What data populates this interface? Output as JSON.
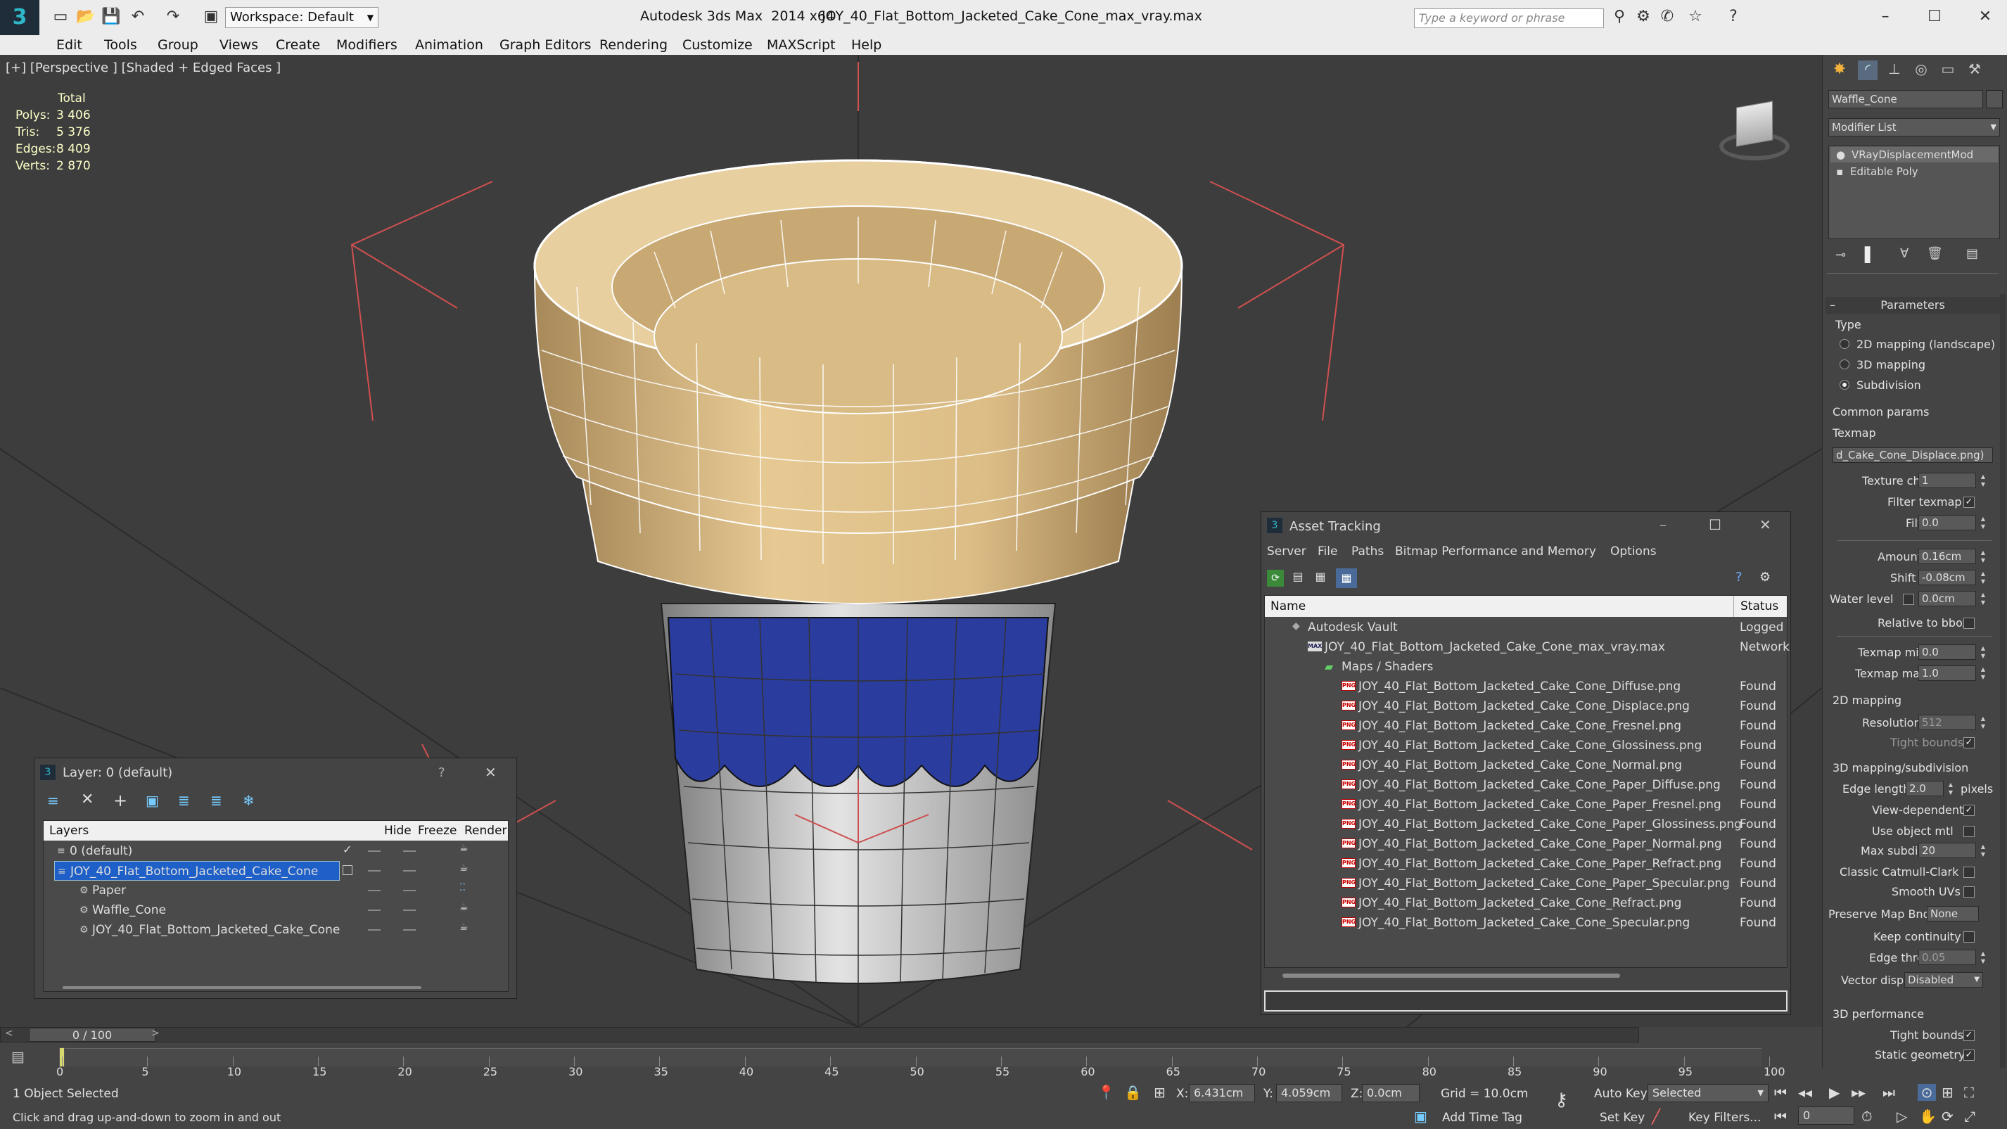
{
  "titlebar": {
    "app_title": "Autodesk 3ds Max  2014 x64",
    "file_title": "JOY_40_Flat_Bottom_Jacketed_Cake_Cone_max_vray.max",
    "workspace": "Workspace: Default",
    "search_placeholder": "Type a keyword or phrase"
  },
  "menu": [
    "Edit",
    "Tools",
    "Group",
    "Views",
    "Create",
    "Modifiers",
    "Animation",
    "Graph Editors",
    "Rendering",
    "Customize",
    "MAXScript",
    "Help"
  ],
  "viewport": {
    "label": "[+] [Perspective ] [Shaded + Edged Faces ]",
    "stats": {
      "header": "Total",
      "rows": [
        {
          "label": "Polys:",
          "value": "3 406"
        },
        {
          "label": "Tris:",
          "value": "5 376"
        },
        {
          "label": "Edges:",
          "value": "8 409"
        },
        {
          "label": "Verts:",
          "value": "2 870"
        }
      ]
    }
  },
  "command_panel": {
    "object_name": "Waffle_Cone",
    "modifier_list": "Modifier List",
    "stack": [
      "VRayDisplacementMod",
      "Editable Poly"
    ],
    "rollout_title": "Parameters",
    "type_label": "Type",
    "types": [
      {
        "label": "2D mapping (landscape)",
        "selected": false
      },
      {
        "label": "3D mapping",
        "selected": false
      },
      {
        "label": "Subdivision",
        "selected": true
      }
    ],
    "common_params": "Common params",
    "texmap_label": "Texmap",
    "texmap_value": "d_Cake_Cone_Displace.png)",
    "texture_chan_label": "Texture chan",
    "texture_chan_value": "1",
    "filter_texmap_label": "Filter texmap",
    "filter_blur_label": "Filter blur",
    "filter_blur_value": "0.0",
    "amount_label": "Amount",
    "amount_value": "0.16cm",
    "shift_label": "Shift",
    "shift_value": "-0.08cm",
    "water_level_label": "Water level",
    "water_level_value": "0.0cm",
    "relative_bbox_label": "Relative to bbox",
    "texmap_min_label": "Texmap min",
    "texmap_min_value": "0.0",
    "texmap_max_label": "Texmap max",
    "texmap_max_value": "1.0",
    "mapping_2d": "2D mapping",
    "resolution_label": "Resolution",
    "resolution_value": "512",
    "tight_bounds_label": "Tight bounds",
    "subdiv_3d": "3D mapping/subdivision",
    "edge_length_label": "Edge length",
    "edge_length_value": "2.0",
    "pixels_label": "pixels",
    "view_dependent_label": "View-dependent",
    "use_object_mtl_label": "Use object mtl",
    "max_subdivs_label": "Max subdivs",
    "max_subdivs_value": "20",
    "classic_catmull_label": "Classic Catmull-Clark",
    "smooth_uvs_label": "Smooth UVs",
    "preserve_map_label": "Preserve Map Bnd",
    "preserve_map_value": "None",
    "keep_continuity_label": "Keep continuity",
    "edge_thresh_label": "Edge thresh",
    "edge_thresh_value": "0.05",
    "vector_displ_label": "Vector displ",
    "vector_displ_value": "Disabled",
    "perf_3d": "3D performance",
    "tight_bounds2_label": "Tight bounds",
    "static_geometry_label": "Static geometry"
  },
  "asset_tracking": {
    "title": "Asset Tracking",
    "menu": [
      "Server",
      "File",
      "Paths",
      "Bitmap Performance and Memory",
      "Options"
    ],
    "col_name": "Name",
    "col_status": "Status",
    "vault": {
      "name": "Autodesk Vault",
      "status": "Logged"
    },
    "max_file": {
      "name": "JOY_40_Flat_Bottom_Jacketed_Cake_Cone_max_vray.max",
      "status": "Network"
    },
    "maps_folder": "Maps / Shaders",
    "files": [
      {
        "name": "JOY_40_Flat_Bottom_Jacketed_Cake_Cone_Diffuse.png",
        "status": "Found"
      },
      {
        "name": "JOY_40_Flat_Bottom_Jacketed_Cake_Cone_Displace.png",
        "status": "Found"
      },
      {
        "name": "JOY_40_Flat_Bottom_Jacketed_Cake_Cone_Fresnel.png",
        "status": "Found"
      },
      {
        "name": "JOY_40_Flat_Bottom_Jacketed_Cake_Cone_Glossiness.png",
        "status": "Found"
      },
      {
        "name": "JOY_40_Flat_Bottom_Jacketed_Cake_Cone_Normal.png",
        "status": "Found"
      },
      {
        "name": "JOY_40_Flat_Bottom_Jacketed_Cake_Cone_Paper_Diffuse.png",
        "status": "Found"
      },
      {
        "name": "JOY_40_Flat_Bottom_Jacketed_Cake_Cone_Paper_Fresnel.png",
        "status": "Found"
      },
      {
        "name": "JOY_40_Flat_Bottom_Jacketed_Cake_Cone_Paper_Glossiness.png",
        "status": "Found"
      },
      {
        "name": "JOY_40_Flat_Bottom_Jacketed_Cake_Cone_Paper_Normal.png",
        "status": "Found"
      },
      {
        "name": "JOY_40_Flat_Bottom_Jacketed_Cake_Cone_Paper_Refract.png",
        "status": "Found"
      },
      {
        "name": "JOY_40_Flat_Bottom_Jacketed_Cake_Cone_Paper_Specular.png",
        "status": "Found"
      },
      {
        "name": "JOY_40_Flat_Bottom_Jacketed_Cake_Cone_Refract.png",
        "status": "Found"
      },
      {
        "name": "JOY_40_Flat_Bottom_Jacketed_Cake_Cone_Specular.png",
        "status": "Found"
      }
    ]
  },
  "layer_dialog": {
    "title": "Layer: 0 (default)",
    "help": "?",
    "col_layers": "Layers",
    "col_hide": "Hide",
    "col_freeze": "Freeze",
    "col_render": "Render",
    "rows": [
      {
        "name": "0 (default)",
        "indent": 0,
        "selected": false
      },
      {
        "name": "JOY_40_Flat_Bottom_Jacketed_Cake_Cone",
        "indent": 0,
        "selected": true
      },
      {
        "name": "Paper",
        "indent": 1,
        "selected": false
      },
      {
        "name": "Waffle_Cone",
        "indent": 1,
        "selected": false
      },
      {
        "name": "JOY_40_Flat_Bottom_Jacketed_Cake_Cone",
        "indent": 1,
        "selected": false
      }
    ]
  },
  "timeline": {
    "frame": "0 / 100",
    "ticks": [
      "0",
      "5",
      "10",
      "15",
      "20",
      "25",
      "30",
      "35",
      "40",
      "45",
      "50",
      "55",
      "60",
      "65",
      "70",
      "75",
      "80",
      "85",
      "90",
      "95",
      "100"
    ]
  },
  "statusbar": {
    "selection": "1 Object Selected",
    "prompt": "Click and drag up-and-down to zoom in and out",
    "x_label": "X:",
    "x_value": "6.431cm",
    "y_label": "Y:",
    "y_value": "4.059cm",
    "z_label": "Z:",
    "z_value": "0.0cm",
    "grid": "Grid = 10.0cm",
    "add_time_tag": "Add Time Tag",
    "auto_key": "Auto Key",
    "selected_value": "Selected",
    "set_key": "Set Key",
    "key_filters": "Key Filters...",
    "frame_field": "0"
  },
  "colors": {
    "viewport_bg": "#3d3d3d",
    "selection_blue": "#1e5fc8",
    "stats_text": "#ffffc8"
  }
}
